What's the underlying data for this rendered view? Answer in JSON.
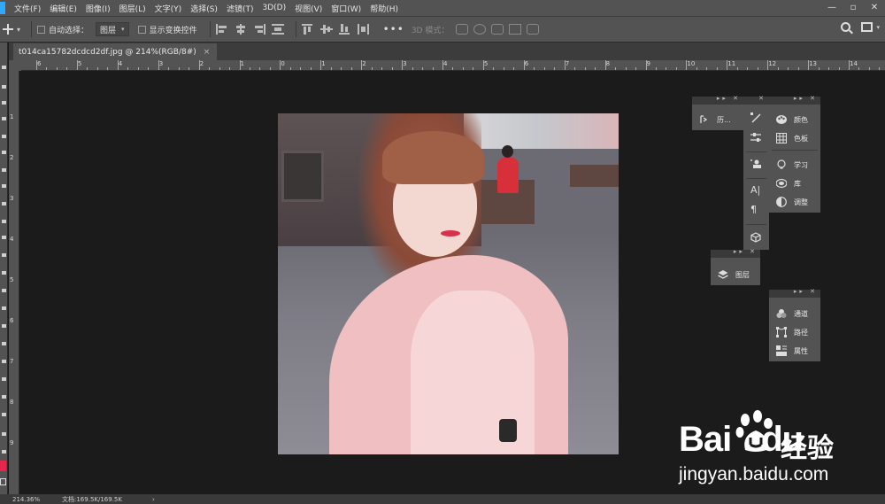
{
  "menubar": {
    "items": [
      "文件(F)",
      "编辑(E)",
      "图像(I)",
      "图层(L)",
      "文字(Y)",
      "选择(S)",
      "滤镜(T)",
      "3D(D)",
      "视图(V)",
      "窗口(W)",
      "帮助(H)"
    ],
    "window_controls": [
      "—",
      "▫",
      "✕"
    ]
  },
  "options": {
    "auto_select_label": "自动选择：",
    "auto_select_value": "图层",
    "show_transform_label": "显示变换控件",
    "more_label": "•••",
    "mode_3d_label": "3D 模式："
  },
  "document": {
    "tab_title": "t014ca15782dcdcd2df.jpg @ 214%(RGB/8#)",
    "tab_close": "×"
  },
  "rulers": {
    "horizontal": [
      "6",
      "5",
      "4",
      "3",
      "2",
      "1",
      "0",
      "1",
      "2",
      "3",
      "4",
      "5",
      "6",
      "7",
      "8",
      "9",
      "10",
      "11",
      "12",
      "13",
      "14"
    ],
    "vertical": [
      "1",
      "2",
      "3",
      "4",
      "5",
      "6",
      "7",
      "8",
      "9"
    ]
  },
  "panels": {
    "history": "历...",
    "color": "颜色",
    "swatches": "色板",
    "learn": "学习",
    "libraries": "库",
    "adjustments": "调整",
    "layers": "图层",
    "channels": "通道",
    "paths": "路径",
    "properties": "属性"
  },
  "statusbar": {
    "zoom": "214.36%",
    "doc_info": "文档:169.5K/169.5K",
    "arrow": "›"
  },
  "watermark": {
    "logo_text": "Bai",
    "logo_text2": "du",
    "cn_text": "经验",
    "url": "jingyan.baidu.com"
  },
  "colors": {
    "foreground": "#e8264c",
    "accent_ps": "#31a8ff"
  }
}
